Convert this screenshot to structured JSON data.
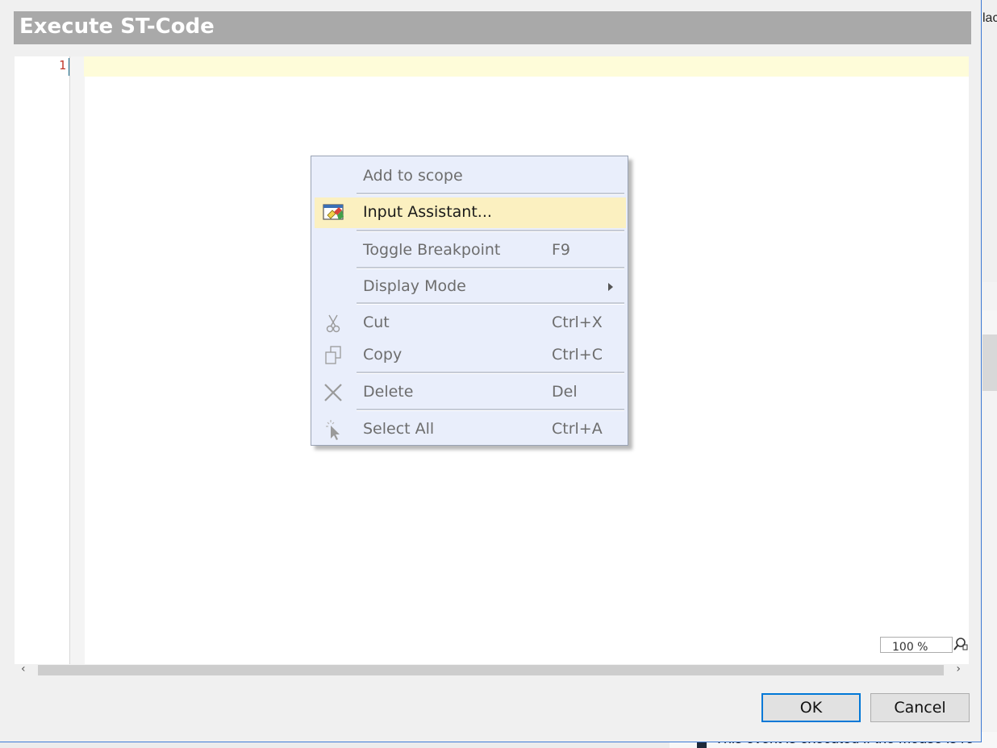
{
  "dialog": {
    "title": "Execute ST-Code",
    "ok_label": "OK",
    "cancel_label": "Cancel"
  },
  "editor": {
    "line_numbers": [
      "1"
    ],
    "zoom_value": "100 %"
  },
  "context_menu": {
    "items": [
      {
        "label": "Add to scope",
        "shortcut": "",
        "icon": "none"
      },
      {
        "label": "Input Assistant...",
        "shortcut": "",
        "icon": "input-assistant-icon"
      },
      {
        "label": "Toggle Breakpoint",
        "shortcut": "F9",
        "icon": "none"
      },
      {
        "label": "Display Mode",
        "shortcut": "",
        "icon": "none"
      },
      {
        "label": "Cut",
        "shortcut": "Ctrl+X",
        "icon": "scissors-icon"
      },
      {
        "label": "Copy",
        "shortcut": "Ctrl+C",
        "icon": "copy-icon"
      },
      {
        "label": "Delete",
        "shortcut": "Del",
        "icon": "delete-x-icon"
      },
      {
        "label": "Select All",
        "shortcut": "Ctrl+A",
        "icon": "select-all-icon"
      }
    ]
  },
  "background": {
    "right_fragment": "lac",
    "bottom_fragment": "This event is executed if the mouse is re"
  },
  "colors": {
    "title_bar": "#a9a9a9",
    "menu_bg": "#e9eefb",
    "menu_highlight": "#fbf0c0",
    "current_line": "#fefcd9",
    "ok_border": "#0078d7"
  }
}
